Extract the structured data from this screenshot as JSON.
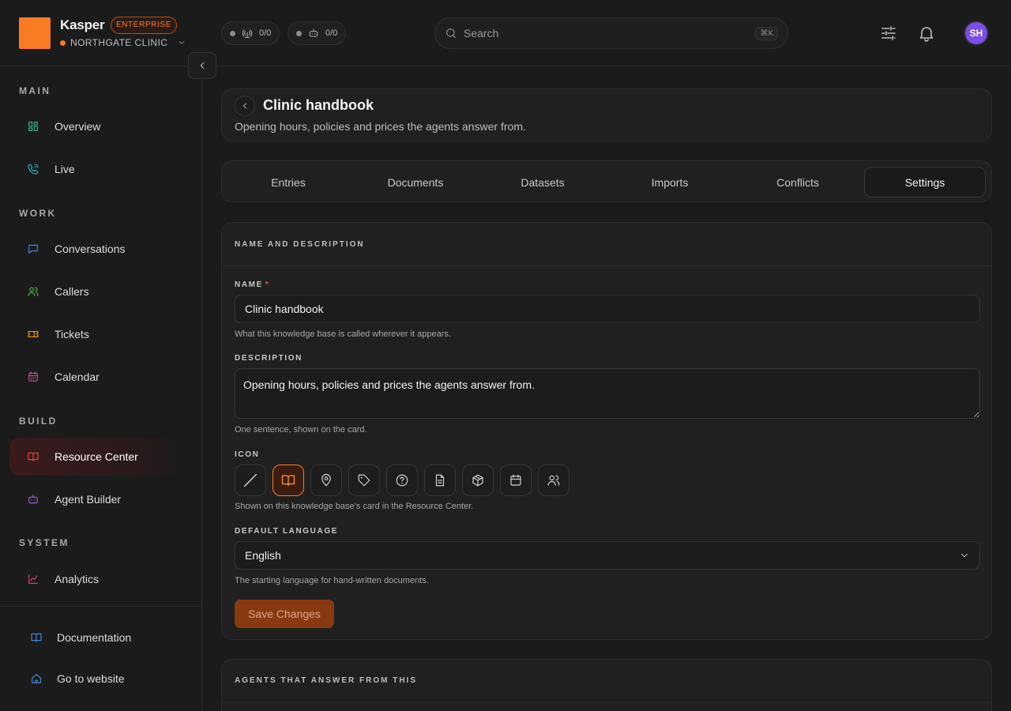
{
  "app": {
    "brand": "Kasper",
    "plan_badge": "ENTERPRISE",
    "workspace": "NORTHGATE CLINIC",
    "workspace_status_color": "#fb7a24",
    "accent": "#fb7a24"
  },
  "status_pills": [
    {
      "icon": "broadcast-icon",
      "value": "0/0"
    },
    {
      "icon": "bot-icon",
      "value": "0/0"
    }
  ],
  "search": {
    "placeholder": "Search",
    "shortcut": "⌘K"
  },
  "user": {
    "initials": "SH",
    "avatar_color": "#7a4ee8"
  },
  "sidebar": {
    "sections": [
      {
        "label": "MAIN",
        "items": [
          {
            "label": "Overview",
            "icon": "grid-icon",
            "color": "#3fbf8a"
          },
          {
            "label": "Live",
            "icon": "phone-icon",
            "color": "#2eb6d6"
          }
        ]
      },
      {
        "label": "WORK",
        "items": [
          {
            "label": "Conversations",
            "icon": "chat-icon",
            "color": "#4a8ef0"
          },
          {
            "label": "Callers",
            "icon": "users-icon",
            "color": "#5fc04a"
          },
          {
            "label": "Tickets",
            "icon": "ticket-icon",
            "color": "#f0a020"
          },
          {
            "label": "Calendar",
            "icon": "calendar-icon",
            "color": "#d04a9a"
          }
        ]
      },
      {
        "label": "BUILD",
        "items": [
          {
            "label": "Resource Center",
            "icon": "book-icon",
            "color": "#f04848",
            "active": true
          },
          {
            "label": "Agent Builder",
            "icon": "bot-icon",
            "color": "#a65ef0"
          }
        ]
      },
      {
        "label": "SYSTEM",
        "items": [
          {
            "label": "Analytics",
            "icon": "chart-icon",
            "color": "#e0458a"
          }
        ]
      }
    ],
    "footer": [
      {
        "label": "Documentation",
        "icon": "book-icon",
        "color": "#4a8ef0"
      },
      {
        "label": "Go to website",
        "icon": "home-icon",
        "color": "#4a8ef0"
      }
    ]
  },
  "page": {
    "title": "Clinic handbook",
    "subtitle": "Opening hours, policies and prices the agents answer from."
  },
  "tabs": [
    {
      "label": "Entries"
    },
    {
      "label": "Documents"
    },
    {
      "label": "Datasets"
    },
    {
      "label": "Imports"
    },
    {
      "label": "Conflicts"
    },
    {
      "label": "Settings",
      "active": true
    }
  ],
  "settings": {
    "section_title": "NAME AND DESCRIPTION",
    "name": {
      "label": "NAME",
      "required_mark": "*",
      "value": "Clinic handbook",
      "help": "What this knowledge base is called wherever it appears."
    },
    "description": {
      "label": "DESCRIPTION",
      "value": "Opening hours, policies and prices the agents answer from.",
      "help": "One sentence, shown on the card."
    },
    "icon": {
      "label": "ICON",
      "options": [
        "none-icon",
        "book-icon",
        "map-pin-icon",
        "tag-icon",
        "help-circle-icon",
        "document-icon",
        "box-icon",
        "calendar-icon",
        "users-icon"
      ],
      "selected": "book-icon",
      "help": "Shown on this knowledge base's card in the Resource Center."
    },
    "language": {
      "label": "DEFAULT LANGUAGE",
      "value": "English",
      "help": "The starting language for hand-written documents."
    },
    "save_label": "Save Changes"
  },
  "agents_section": {
    "title": "AGENTS THAT ANSWER FROM THIS"
  }
}
